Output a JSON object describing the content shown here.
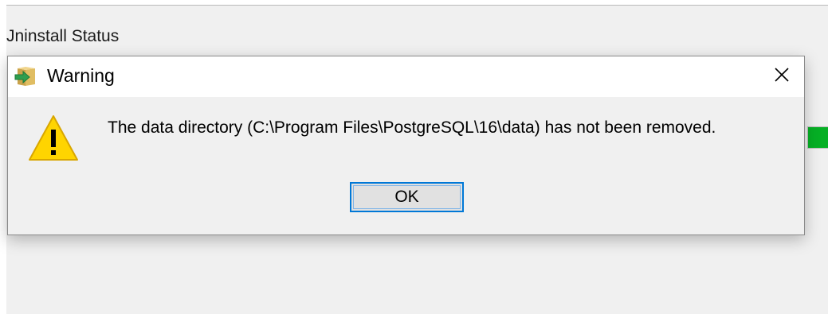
{
  "background_window": {
    "section_title": "Jninstall Status",
    "progress_color": "#06b025"
  },
  "dialog": {
    "title": "Warning",
    "app_icon": "installer-package-icon",
    "close_icon": "close-icon",
    "warning_icon": "warning-triangle-icon",
    "message": "The data directory (C:\\Program Files\\PostgreSQL\\16\\data) has not been removed.",
    "ok_label": "OK",
    "accent_color": "#0078d7"
  }
}
